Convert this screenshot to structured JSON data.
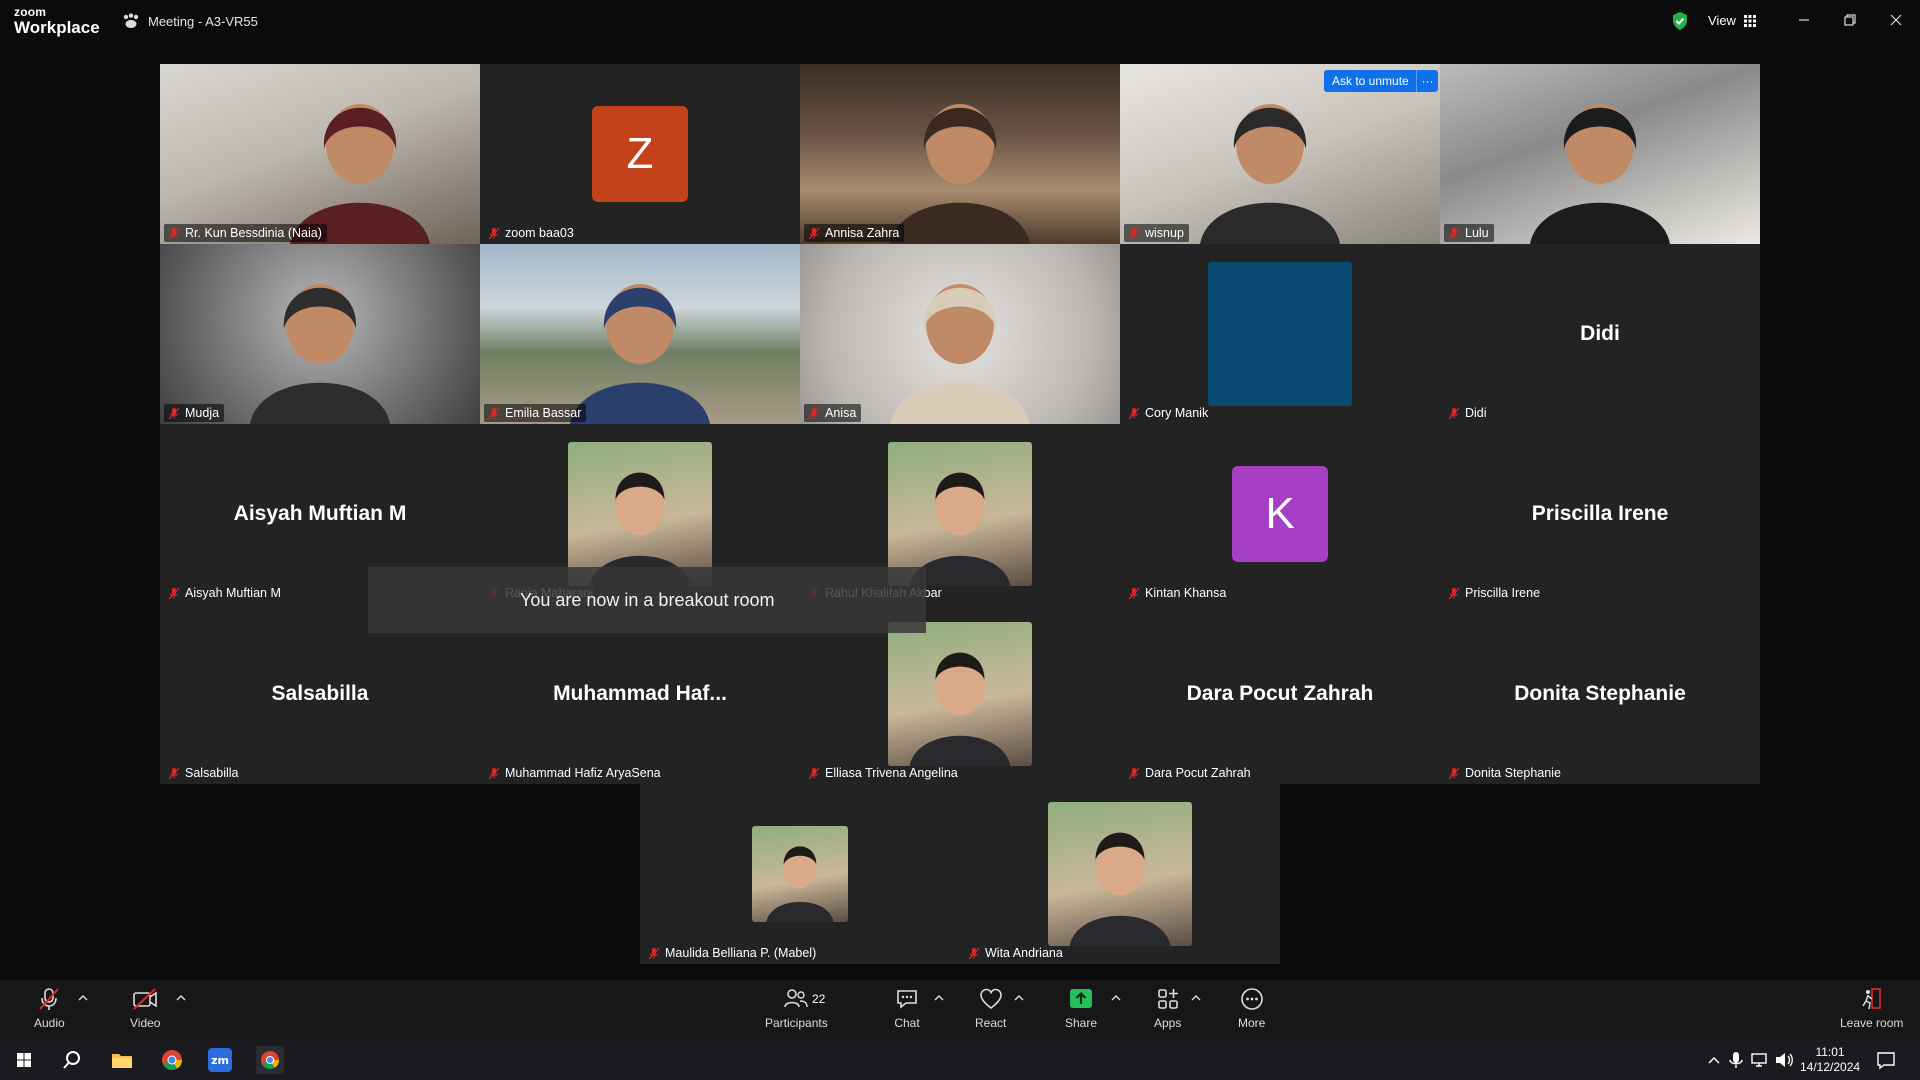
{
  "app": {
    "logo_line1": "zoom",
    "logo_line2": "Workplace",
    "meeting_title": "Meeting - A3-VR55",
    "view_label": "View"
  },
  "colors": {
    "accent": "#0e71eb",
    "active_speaker": "#2ecf68",
    "muted_icon": "#e02828",
    "tile_bg": "#232323"
  },
  "tiles": [
    {
      "name": "Rr. Kun Bessdinia (Naia)",
      "kind": "video"
    },
    {
      "name": "zoom baa03",
      "kind": "avatar",
      "initial": "Z",
      "color": "#c4421a"
    },
    {
      "name": "Annisa Zahra",
      "kind": "video"
    },
    {
      "name": "wisnup",
      "kind": "video"
    },
    {
      "name": "Lulu",
      "kind": "video"
    },
    {
      "name": "Mudja",
      "kind": "video"
    },
    {
      "name": "Emilia Bassar",
      "kind": "video",
      "active": true
    },
    {
      "name": "Anisa",
      "kind": "video"
    },
    {
      "name": "Cory Manik",
      "kind": "avatar-blank",
      "color": "#0a4a72"
    },
    {
      "name": "Didi",
      "kind": "name",
      "big": "Didi"
    },
    {
      "name": "Aisyah Muftian M",
      "kind": "name",
      "big": "Aisyah Muftian M"
    },
    {
      "name": "Rania Maharani",
      "kind": "photo"
    },
    {
      "name": "Rahul Khalifah Akbar",
      "kind": "photo"
    },
    {
      "name": "Kintan Khansa",
      "kind": "avatar",
      "initial": "K",
      "color": "#a63fc4"
    },
    {
      "name": "Priscilla Irene",
      "kind": "name",
      "big": "Priscilla Irene"
    },
    {
      "name": "Salsabilla",
      "kind": "name",
      "big": "Salsabilla"
    },
    {
      "name": "Muhammad Hafiz AryaSena",
      "kind": "name",
      "big": "Muhammad  Haf..."
    },
    {
      "name": "Elliasa Trivena Angelina",
      "kind": "photo"
    },
    {
      "name": "Dara Pocut Zahrah",
      "kind": "name",
      "big": "Dara Pocut Zahrah"
    },
    {
      "name": "Donita Stephanie",
      "kind": "name",
      "big": "Donita Stephanie"
    },
    {
      "name": "Maulida Belliana P. (Mabel)",
      "kind": "photo-small"
    },
    {
      "name": "Wita Andriana",
      "kind": "photo"
    }
  ],
  "ask_unmute": {
    "label": "Ask to unmute",
    "more": "···"
  },
  "toast": "You are now in a breakout room",
  "toolbar": {
    "audio": "Audio",
    "video": "Video",
    "participants": "Participants",
    "participants_count": "22",
    "chat": "Chat",
    "react": "React",
    "share": "Share",
    "apps": "Apps",
    "more": "More",
    "leave": "Leave room"
  },
  "taskbar": {
    "time": "11:01",
    "date": "14/12/2024"
  }
}
